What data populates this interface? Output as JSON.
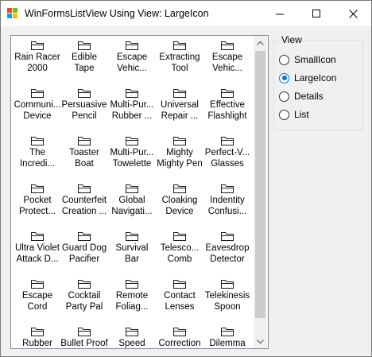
{
  "window": {
    "title": "WinFormsListView Using View: LargeIcon"
  },
  "list_items": [
    "Rain Racer\n2000",
    "Edible\nTape",
    "Escape\nVehic...",
    "Extracting\nTool",
    "Escape\nVehic...",
    "Communi...\nDevice",
    "Persuasive\nPencil",
    "Multi-Pur...\nRubber ...",
    "Universal\nRepair ...",
    "Effective\nFlashlight",
    "The\nIncredi...",
    "Toaster\nBoat",
    "Multi-Pur...\nTowelette",
    "Mighty\nMighty Pen",
    "Perfect-V...\nGlasses",
    "Pocket\nProtect...",
    "Counterfeit\nCreation ...",
    "Global\nNavigati...",
    "Cloaking\nDevice",
    "Indentity\nConfusi...",
    "Ultra Violet\nAttack D...",
    "Guard Dog\nPacifier",
    "Survival\nBar",
    "Telesco...\nComb",
    "Eavesdrop\nDetector",
    "Escape\nCord",
    "Cocktail\nParty Pal",
    "Remote\nFoliag...",
    "Contact\nLenses",
    "Telekinesis\nSpoon",
    "Rubber",
    "Bullet Proof",
    "Speed",
    "Correction",
    "Dilemma"
  ],
  "view_group": {
    "label": "View",
    "options": [
      {
        "label": "SmallIcon",
        "checked": false
      },
      {
        "label": "LargeIcon",
        "checked": true
      },
      {
        "label": "Details",
        "checked": false
      },
      {
        "label": "List",
        "checked": false
      }
    ]
  },
  "colors": {
    "accent": "#0078d7",
    "window_bg": "#f0f0f0",
    "list_bg": "#ffffff",
    "scroll_thumb": "#cdcdcd"
  },
  "icons": {
    "app": "winforms-app-icon",
    "item": "folder-outline-icon",
    "minimize": "minimize-icon",
    "maximize": "maximize-icon",
    "close": "close-icon"
  }
}
